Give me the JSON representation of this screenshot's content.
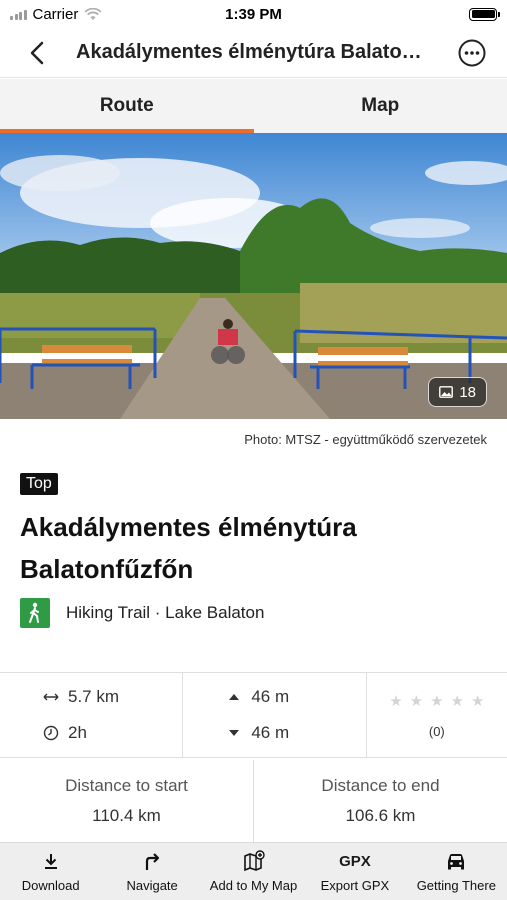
{
  "status_bar": {
    "carrier": "Carrier",
    "time": "1:39 PM"
  },
  "nav": {
    "title": "Akadálymentes élménytúra Balato…",
    "back_icon": "chevron-left-icon",
    "more_icon": "more-horizontal-icon"
  },
  "tabs": [
    {
      "label": "Route",
      "active": true
    },
    {
      "label": "Map",
      "active": false
    }
  ],
  "hero": {
    "photo_count": "18"
  },
  "photo_credit": "Photo: MTSZ - együttműködő szervezetek",
  "badge": "Top",
  "trail": {
    "title": "Akadálymentes élménytúra Balatonfűzfőn",
    "category": "Hiking Trail · Lake Balaton",
    "category_color": "#2f9c45"
  },
  "stats": {
    "distance": "5.7 km",
    "duration": "2h",
    "ascent": "46 m",
    "descent": "46 m",
    "rating_count": "(0)",
    "rating_stars": 0
  },
  "distances": {
    "start_label": "Distance to start",
    "start_value": "110.4 km",
    "end_label": "Distance to end",
    "end_value": "106.6 km"
  },
  "toolbar": {
    "download": "Download",
    "navigate": "Navigate",
    "add_to_my_map": "Add to My Map",
    "export_gpx": "Export GPX",
    "gpx_glyph": "GPX",
    "getting_there": "Getting There"
  },
  "colors": {
    "accent": "#ef6c2c",
    "green": "#2f9c45"
  }
}
